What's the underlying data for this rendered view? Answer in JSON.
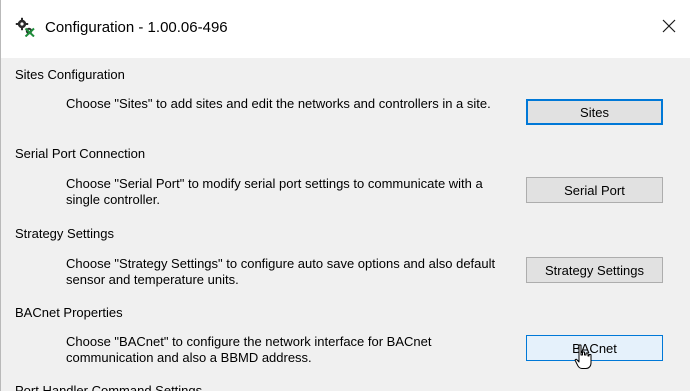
{
  "window": {
    "title": "Configuration - 1.00.06-496",
    "icon": "gears-config-icon",
    "close_icon": "close-x-icon"
  },
  "sections": [
    {
      "title": "Sites Configuration",
      "description": "Choose \"Sites\" to add sites and edit the networks and controllers in a site.",
      "button": "Sites"
    },
    {
      "title": "Serial Port Connection",
      "description": "Choose \"Serial Port\" to modify serial port settings to communicate with a single controller.",
      "button": "Serial Port"
    },
    {
      "title": "Strategy Settings",
      "description": "Choose \"Strategy Settings\" to configure auto save options and also default sensor and temperature units.",
      "button": "Strategy Settings"
    },
    {
      "title": "BACnet Properties",
      "description": "Choose \"BACnet\" to configure the network interface for BACnet communication and also a BBMD address.",
      "button": "BACnet"
    },
    {
      "title": "Port Handler Command Settings"
    }
  ],
  "colors": {
    "accent": "#0078d7",
    "button_face": "#e1e1e1",
    "hover_face": "#e5f1fb",
    "window_bg": "#f0f0f0"
  }
}
